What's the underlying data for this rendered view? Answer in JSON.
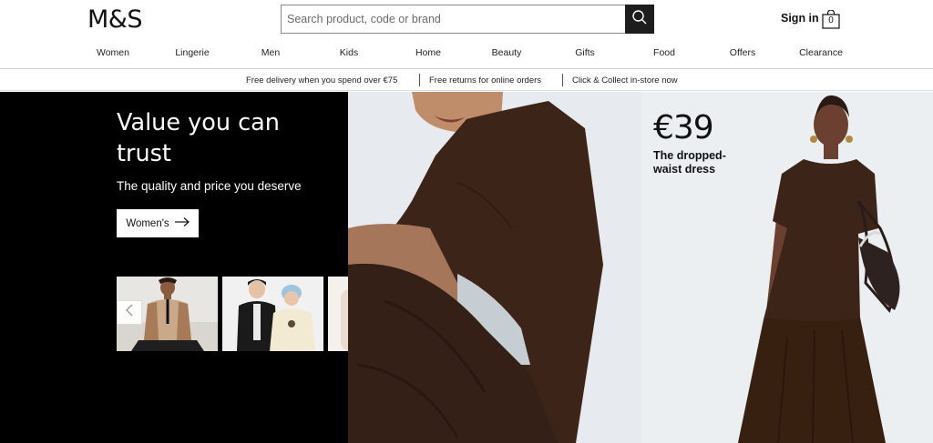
{
  "header": {
    "logo": "M&S",
    "search_placeholder": "Search product, code or brand",
    "sign_in": "Sign in",
    "bag_count": "0"
  },
  "nav": [
    "Women",
    "Lingerie",
    "Men",
    "Kids",
    "Home",
    "Beauty",
    "Gifts",
    "Food",
    "Offers",
    "Clearance"
  ],
  "promo": {
    "items": [
      "Free delivery when you spend over €75",
      "Free returns for online orders",
      "Click & Collect in-store now"
    ]
  },
  "hero": {
    "title": "Value you can trust",
    "subtitle": "The quality and price you deserve",
    "cta_label": "Women's",
    "price": "€39",
    "price_desc": "The dropped-waist dress"
  },
  "colors": {
    "black": "#000000",
    "dress_brown": "#3d2418",
    "background_light": "#eceff1"
  },
  "icons": {
    "search": "search-icon",
    "bag": "shopping-bag-icon",
    "arrow": "arrow-right-icon",
    "prev": "chevron-left-icon",
    "next": "chevron-right-icon"
  }
}
